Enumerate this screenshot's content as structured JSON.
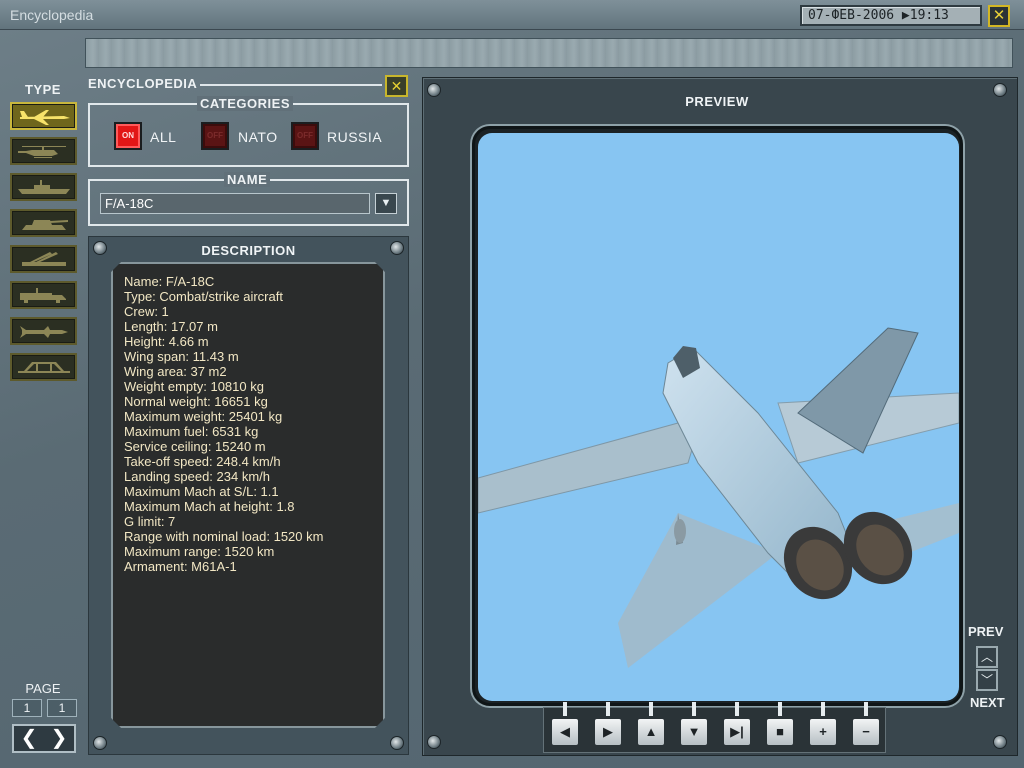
{
  "window": {
    "title": "Encyclopedia",
    "datetime": "07-ФЕВ-2006 ▶19:13",
    "close_label": "✕"
  },
  "type_panel": {
    "heading": "TYPE",
    "items": [
      {
        "icon": "aircraft-icon",
        "active": true
      },
      {
        "icon": "helicopter-icon",
        "active": false
      },
      {
        "icon": "ship-icon",
        "active": false
      },
      {
        "icon": "tank-icon",
        "active": false
      },
      {
        "icon": "sam-launcher-icon",
        "active": false
      },
      {
        "icon": "truck-icon",
        "active": false
      },
      {
        "icon": "missile-icon",
        "active": false
      },
      {
        "icon": "bridge-icon",
        "active": false
      }
    ],
    "page_label": "PAGE",
    "page_current": "1",
    "page_total": "1",
    "prev_arrow": "❮",
    "next_arrow": "❯"
  },
  "encyclopedia": {
    "label": "ENCYCLOPEDIA",
    "close_label": "✕",
    "categories": {
      "title": "CATEGORIES",
      "items": [
        {
          "label": "ALL",
          "state": "ON",
          "on": true
        },
        {
          "label": "NATO",
          "state": "OFF",
          "on": false
        },
        {
          "label": "RUSSIA",
          "state": "OFF",
          "on": false
        }
      ]
    },
    "name": {
      "title": "NAME",
      "value": "F/A-18C",
      "dropdown_icon": "▼"
    }
  },
  "description": {
    "title": "DESCRIPTION",
    "lines": [
      "Name: F/A-18C",
      "Type: Combat/strike aircraft",
      "Crew: 1",
      "Length: 17.07 m",
      "Height: 4.66 m",
      "Wing span: 11.43 m",
      "Wing area: 37 m2",
      "Weight empty: 10810 kg",
      "Normal weight: 16651 kg",
      "Maximum weight: 25401 kg",
      "Maximum fuel: 6531 kg",
      "Service ceiling: 15240 m",
      "Take-off speed: 248.4 km/h",
      "Landing speed: 234 km/h",
      "Maximum Mach at S/L: 1.1",
      "Maximum Mach at height: 1.8",
      "G limit: 7",
      "Range with nominal load: 1520 km",
      "Maximum range: 1520 km",
      "Armament: M61A-1"
    ]
  },
  "preview": {
    "title": "PREVIEW",
    "prev_label": "PREV",
    "next_label": "NEXT",
    "prev_arrow": "︿",
    "next_arrow": "﹀",
    "controls": [
      {
        "name": "rotate-left-button",
        "glyph": "◀"
      },
      {
        "name": "rotate-right-button",
        "glyph": "▶"
      },
      {
        "name": "rotate-up-button",
        "glyph": "▲"
      },
      {
        "name": "rotate-down-button",
        "glyph": "▼"
      },
      {
        "name": "play-button",
        "glyph": "▶|"
      },
      {
        "name": "stop-button",
        "glyph": "■"
      },
      {
        "name": "zoom-in-button",
        "glyph": "+"
      },
      {
        "name": "zoom-out-button",
        "glyph": "−"
      }
    ]
  },
  "colors": {
    "sky": "#87c5f2",
    "accent_yellow": "#e6cf38",
    "toggle_on": "#e21616"
  }
}
